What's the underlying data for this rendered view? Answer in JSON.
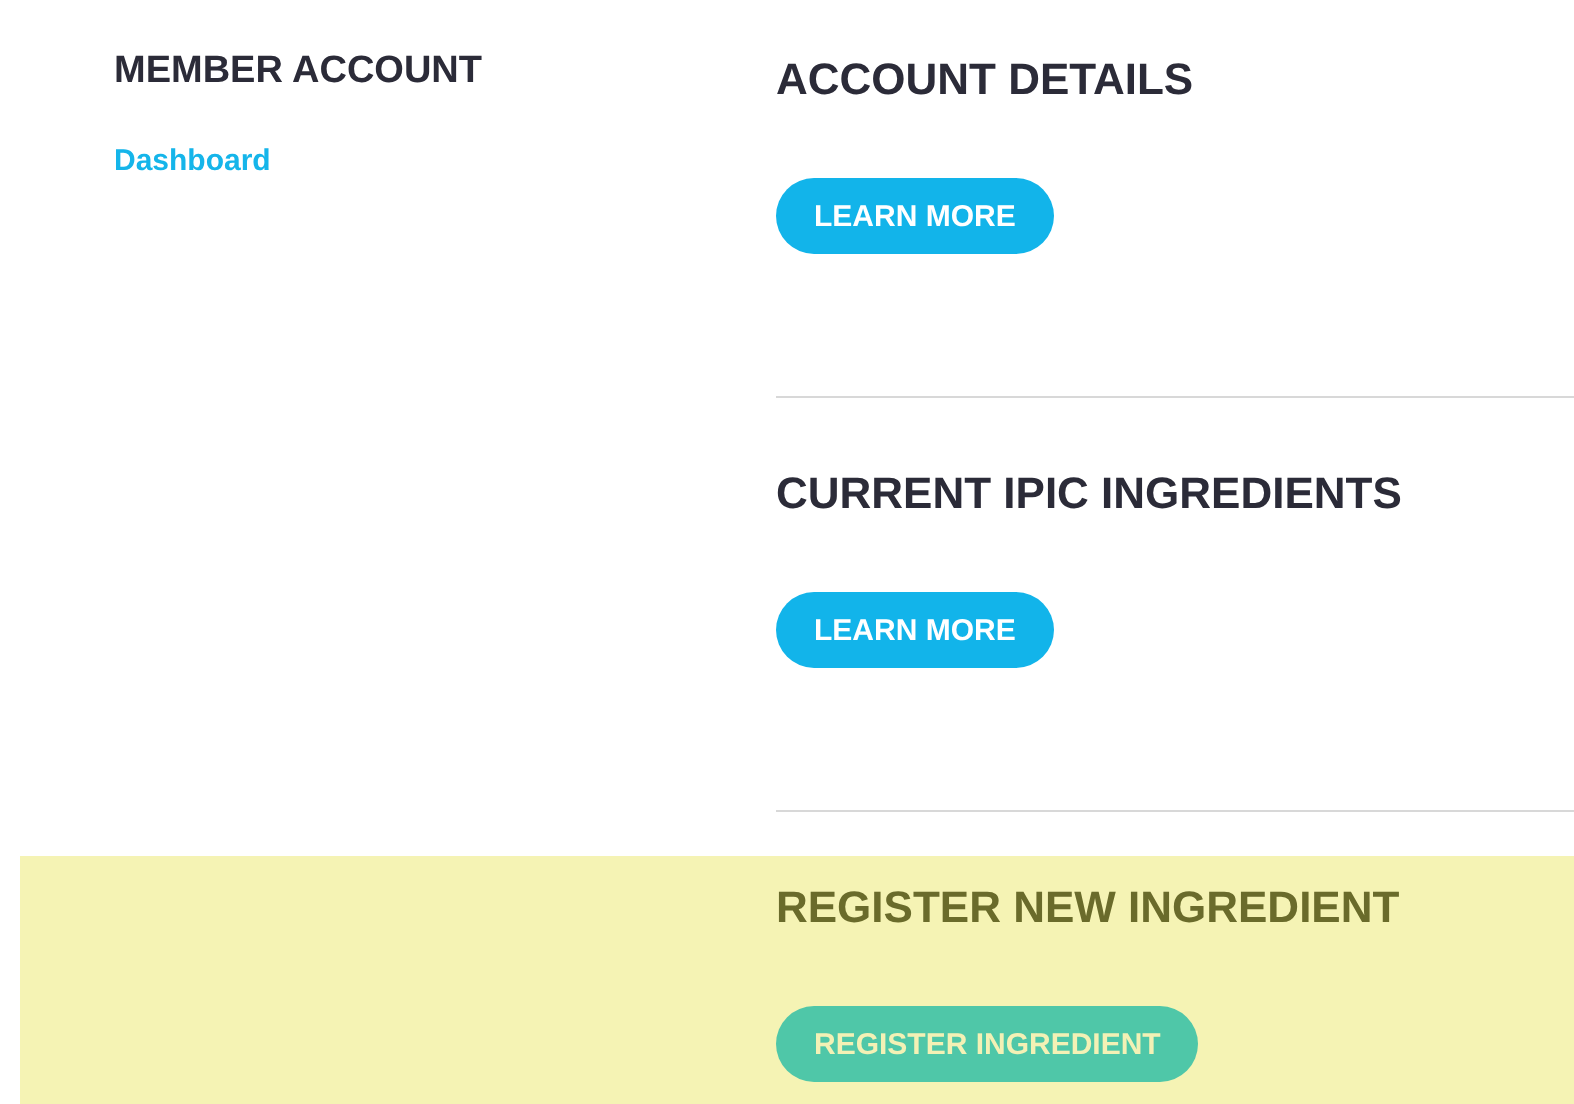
{
  "sidebar": {
    "title": "MEMBER ACCOUNT",
    "items": [
      {
        "label": "Dashboard"
      }
    ]
  },
  "sections": [
    {
      "title": "ACCOUNT DETAILS",
      "button": "LEARN MORE",
      "highlighted": false
    },
    {
      "title": "CURRENT IPIC INGREDIENTS",
      "button": "LEARN MORE",
      "highlighted": false
    },
    {
      "title": "REGISTER NEW INGREDIENT",
      "button": "REGISTER INGREDIENT",
      "highlighted": true
    }
  ]
}
